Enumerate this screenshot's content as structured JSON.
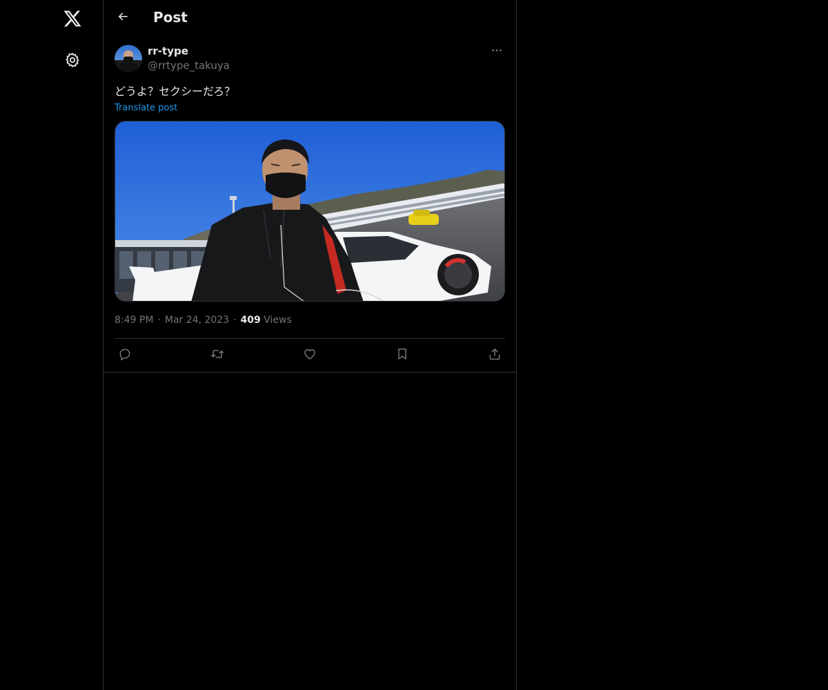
{
  "nav": {
    "logo_icon": "x-logo-icon",
    "settings_icon": "gear-icon"
  },
  "header": {
    "back_icon": "arrow-left-icon",
    "title": "Post"
  },
  "post": {
    "author": {
      "display_name": "rr-type",
      "handle": "@rrtype_takuya"
    },
    "more_icon": "more-dots-icon",
    "text": "どうよ？セクシーだろ？",
    "translate_label": "Translate post",
    "media_description_icon": "photo",
    "time": "8:49 PM",
    "date": "Mar 24, 2023",
    "views_count": "409",
    "views_label": "Views",
    "actions": [
      {
        "icon": "reply-icon"
      },
      {
        "icon": "repost-icon"
      },
      {
        "icon": "like-icon"
      },
      {
        "icon": "bookmark-icon"
      },
      {
        "icon": "share-icon"
      }
    ]
  },
  "colors": {
    "background": "#000000",
    "text_primary": "#e7e9ea",
    "text_secondary": "#71767b",
    "accent": "#1d9bf0",
    "border": "#2f3336"
  }
}
